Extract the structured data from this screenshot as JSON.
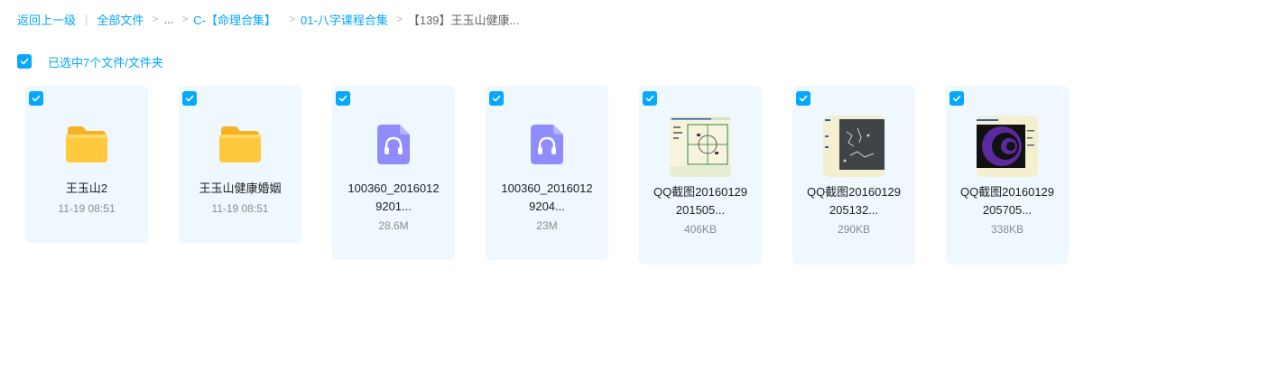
{
  "breadcrumb": {
    "back": "返回上一级",
    "all_files": "全部文件",
    "ellipsis": "...",
    "level1": "C-【命理合集】",
    "level2": "01-八字课程合集",
    "current": "【139】王玉山健康..."
  },
  "selection": {
    "text": "已选中7个文件/文件夹"
  },
  "files": [
    {
      "type": "folder",
      "name": "王玉山2",
      "meta": "11-19 08:51",
      "icon": "folder-icon"
    },
    {
      "type": "folder",
      "name": "王玉山健康婚姻",
      "meta": "11-19 08:51",
      "icon": "folder-icon"
    },
    {
      "type": "audio",
      "name_line1": "100360_2016012",
      "name_line2": "9201...",
      "meta": "28.6M",
      "icon": "audio-file-icon"
    },
    {
      "type": "audio",
      "name_line1": "100360_2016012",
      "name_line2": "9204...",
      "meta": "23M",
      "icon": "audio-file-icon"
    },
    {
      "type": "image",
      "name_line1": "QQ截图20160129",
      "name_line2": "201505...",
      "meta": "406KB",
      "icon": "image-thumbnail"
    },
    {
      "type": "image",
      "name_line1": "QQ截图20160129",
      "name_line2": "205132...",
      "meta": "290KB",
      "icon": "image-thumbnail"
    },
    {
      "type": "image",
      "name_line1": "QQ截图20160129",
      "name_line2": "205705...",
      "meta": "338KB",
      "icon": "image-thumbnail"
    }
  ],
  "colors": {
    "accent": "#06a7ff",
    "card_bg": "#eef8fe",
    "folder": "#ffc83d",
    "audio": "#8f8cff"
  }
}
